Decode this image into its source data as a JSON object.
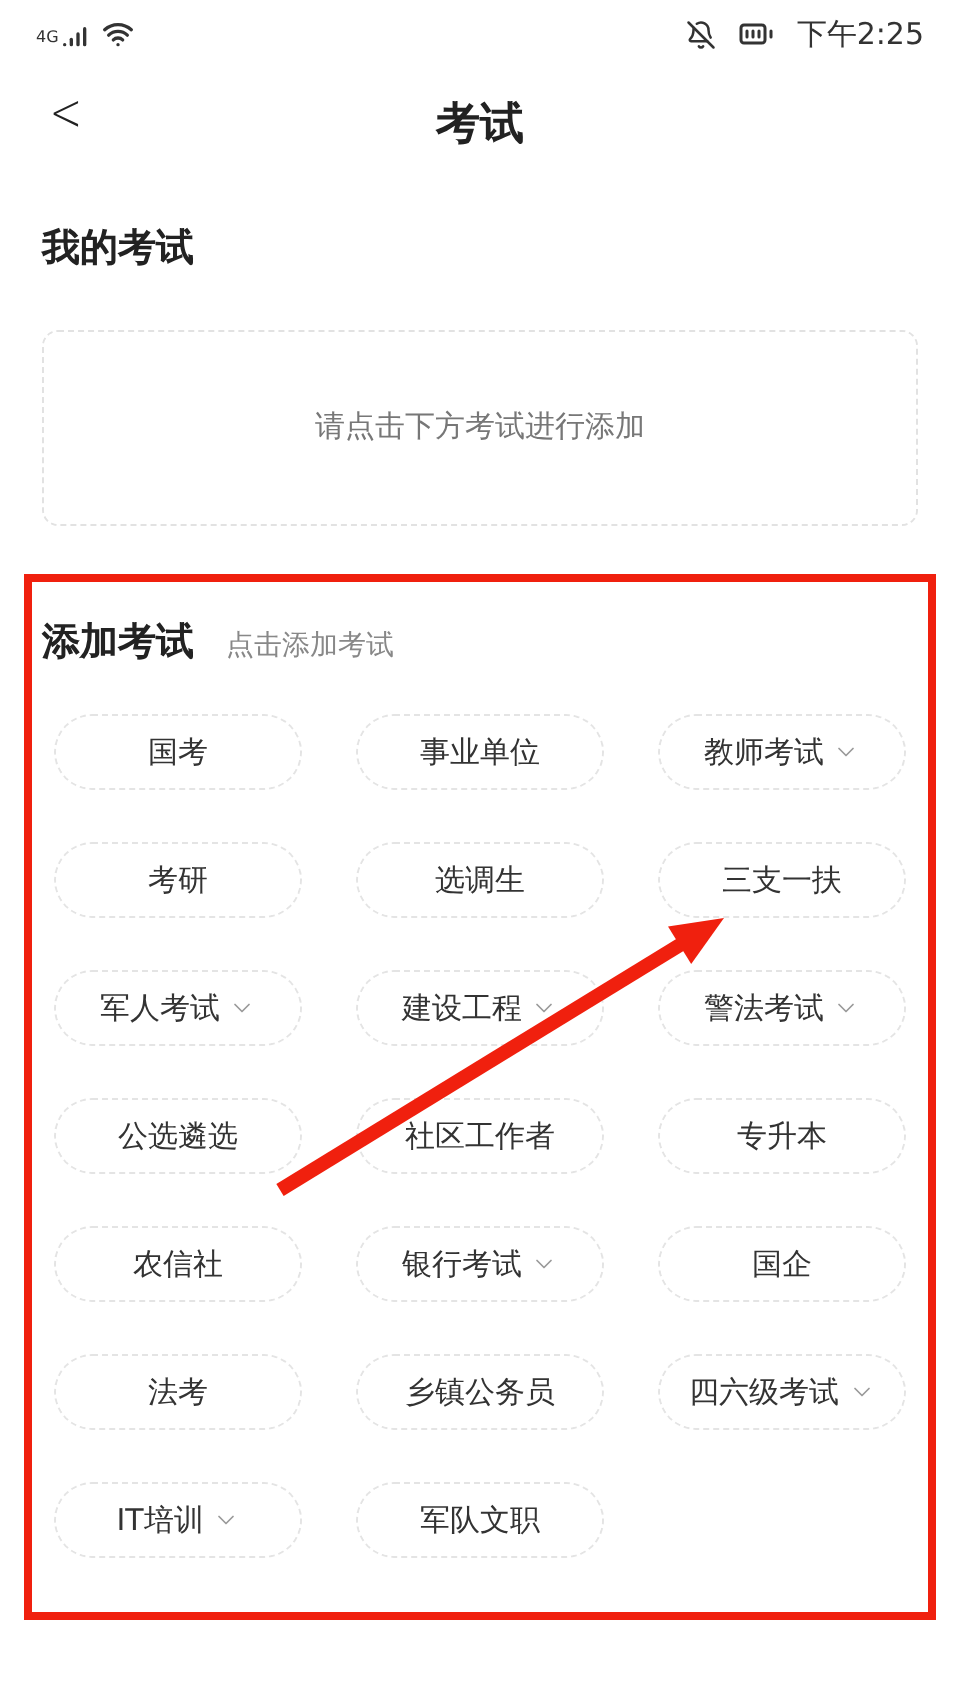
{
  "status_bar": {
    "network": "4G",
    "time": "下午2:25"
  },
  "header": {
    "back": "<",
    "title": "考试"
  },
  "my_exams": {
    "title": "我的考试",
    "empty_hint": "请点击下方考试进行添加"
  },
  "add_exams": {
    "title": "添加考试",
    "subtitle": "点击添加考试",
    "items": [
      {
        "label": "国考",
        "kind": "plain"
      },
      {
        "label": "事业单位",
        "kind": "plain"
      },
      {
        "label": "教师考试",
        "kind": "dropdown"
      },
      {
        "label": "考研",
        "kind": "plain"
      },
      {
        "label": "选调生",
        "kind": "plain"
      },
      {
        "label": "三支一扶",
        "kind": "plain"
      },
      {
        "label": "军人考试",
        "kind": "dropdown"
      },
      {
        "label": "建设工程",
        "kind": "dropdown"
      },
      {
        "label": "警法考试",
        "kind": "dropdown"
      },
      {
        "label": "公选遴选",
        "kind": "plain"
      },
      {
        "label": "社区工作者",
        "kind": "plain"
      },
      {
        "label": "专升本",
        "kind": "plain"
      },
      {
        "label": "农信社",
        "kind": "plain"
      },
      {
        "label": "银行考试",
        "kind": "dropdown"
      },
      {
        "label": "国企",
        "kind": "plain"
      },
      {
        "label": "法考",
        "kind": "plain"
      },
      {
        "label": "乡镇公务员",
        "kind": "plain"
      },
      {
        "label": "四六级考试",
        "kind": "dropdown"
      },
      {
        "label": "IT培训",
        "kind": "dropdown"
      },
      {
        "label": "军队文职",
        "kind": "plain"
      }
    ]
  }
}
